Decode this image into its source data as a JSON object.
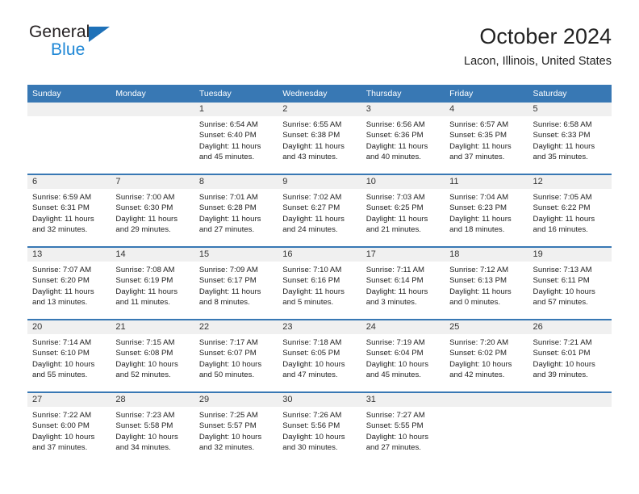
{
  "logo": {
    "text_dark": "General",
    "text_blue": "Blue",
    "triangle_color": "#1e71b8",
    "blue_color": "#1e87d6"
  },
  "header": {
    "title": "October 2024",
    "subtitle": "Lacon, Illinois, United States"
  },
  "theme": {
    "header_bg": "#3878b4",
    "daynum_bg": "#f0f0f0",
    "row_rule": "#3878b4"
  },
  "weekday_headers": [
    "Sunday",
    "Monday",
    "Tuesday",
    "Wednesday",
    "Thursday",
    "Friday",
    "Saturday"
  ],
  "weeks": [
    [
      {
        "day": "",
        "sunrise": "",
        "sunset": "",
        "daylight1": "",
        "daylight2": ""
      },
      {
        "day": "",
        "sunrise": "",
        "sunset": "",
        "daylight1": "",
        "daylight2": ""
      },
      {
        "day": "1",
        "sunrise": "Sunrise: 6:54 AM",
        "sunset": "Sunset: 6:40 PM",
        "daylight1": "Daylight: 11 hours",
        "daylight2": "and 45 minutes."
      },
      {
        "day": "2",
        "sunrise": "Sunrise: 6:55 AM",
        "sunset": "Sunset: 6:38 PM",
        "daylight1": "Daylight: 11 hours",
        "daylight2": "and 43 minutes."
      },
      {
        "day": "3",
        "sunrise": "Sunrise: 6:56 AM",
        "sunset": "Sunset: 6:36 PM",
        "daylight1": "Daylight: 11 hours",
        "daylight2": "and 40 minutes."
      },
      {
        "day": "4",
        "sunrise": "Sunrise: 6:57 AM",
        "sunset": "Sunset: 6:35 PM",
        "daylight1": "Daylight: 11 hours",
        "daylight2": "and 37 minutes."
      },
      {
        "day": "5",
        "sunrise": "Sunrise: 6:58 AM",
        "sunset": "Sunset: 6:33 PM",
        "daylight1": "Daylight: 11 hours",
        "daylight2": "and 35 minutes."
      }
    ],
    [
      {
        "day": "6",
        "sunrise": "Sunrise: 6:59 AM",
        "sunset": "Sunset: 6:31 PM",
        "daylight1": "Daylight: 11 hours",
        "daylight2": "and 32 minutes."
      },
      {
        "day": "7",
        "sunrise": "Sunrise: 7:00 AM",
        "sunset": "Sunset: 6:30 PM",
        "daylight1": "Daylight: 11 hours",
        "daylight2": "and 29 minutes."
      },
      {
        "day": "8",
        "sunrise": "Sunrise: 7:01 AM",
        "sunset": "Sunset: 6:28 PM",
        "daylight1": "Daylight: 11 hours",
        "daylight2": "and 27 minutes."
      },
      {
        "day": "9",
        "sunrise": "Sunrise: 7:02 AM",
        "sunset": "Sunset: 6:27 PM",
        "daylight1": "Daylight: 11 hours",
        "daylight2": "and 24 minutes."
      },
      {
        "day": "10",
        "sunrise": "Sunrise: 7:03 AM",
        "sunset": "Sunset: 6:25 PM",
        "daylight1": "Daylight: 11 hours",
        "daylight2": "and 21 minutes."
      },
      {
        "day": "11",
        "sunrise": "Sunrise: 7:04 AM",
        "sunset": "Sunset: 6:23 PM",
        "daylight1": "Daylight: 11 hours",
        "daylight2": "and 18 minutes."
      },
      {
        "day": "12",
        "sunrise": "Sunrise: 7:05 AM",
        "sunset": "Sunset: 6:22 PM",
        "daylight1": "Daylight: 11 hours",
        "daylight2": "and 16 minutes."
      }
    ],
    [
      {
        "day": "13",
        "sunrise": "Sunrise: 7:07 AM",
        "sunset": "Sunset: 6:20 PM",
        "daylight1": "Daylight: 11 hours",
        "daylight2": "and 13 minutes."
      },
      {
        "day": "14",
        "sunrise": "Sunrise: 7:08 AM",
        "sunset": "Sunset: 6:19 PM",
        "daylight1": "Daylight: 11 hours",
        "daylight2": "and 11 minutes."
      },
      {
        "day": "15",
        "sunrise": "Sunrise: 7:09 AM",
        "sunset": "Sunset: 6:17 PM",
        "daylight1": "Daylight: 11 hours",
        "daylight2": "and 8 minutes."
      },
      {
        "day": "16",
        "sunrise": "Sunrise: 7:10 AM",
        "sunset": "Sunset: 6:16 PM",
        "daylight1": "Daylight: 11 hours",
        "daylight2": "and 5 minutes."
      },
      {
        "day": "17",
        "sunrise": "Sunrise: 7:11 AM",
        "sunset": "Sunset: 6:14 PM",
        "daylight1": "Daylight: 11 hours",
        "daylight2": "and 3 minutes."
      },
      {
        "day": "18",
        "sunrise": "Sunrise: 7:12 AM",
        "sunset": "Sunset: 6:13 PM",
        "daylight1": "Daylight: 11 hours",
        "daylight2": "and 0 minutes."
      },
      {
        "day": "19",
        "sunrise": "Sunrise: 7:13 AM",
        "sunset": "Sunset: 6:11 PM",
        "daylight1": "Daylight: 10 hours",
        "daylight2": "and 57 minutes."
      }
    ],
    [
      {
        "day": "20",
        "sunrise": "Sunrise: 7:14 AM",
        "sunset": "Sunset: 6:10 PM",
        "daylight1": "Daylight: 10 hours",
        "daylight2": "and 55 minutes."
      },
      {
        "day": "21",
        "sunrise": "Sunrise: 7:15 AM",
        "sunset": "Sunset: 6:08 PM",
        "daylight1": "Daylight: 10 hours",
        "daylight2": "and 52 minutes."
      },
      {
        "day": "22",
        "sunrise": "Sunrise: 7:17 AM",
        "sunset": "Sunset: 6:07 PM",
        "daylight1": "Daylight: 10 hours",
        "daylight2": "and 50 minutes."
      },
      {
        "day": "23",
        "sunrise": "Sunrise: 7:18 AM",
        "sunset": "Sunset: 6:05 PM",
        "daylight1": "Daylight: 10 hours",
        "daylight2": "and 47 minutes."
      },
      {
        "day": "24",
        "sunrise": "Sunrise: 7:19 AM",
        "sunset": "Sunset: 6:04 PM",
        "daylight1": "Daylight: 10 hours",
        "daylight2": "and 45 minutes."
      },
      {
        "day": "25",
        "sunrise": "Sunrise: 7:20 AM",
        "sunset": "Sunset: 6:02 PM",
        "daylight1": "Daylight: 10 hours",
        "daylight2": "and 42 minutes."
      },
      {
        "day": "26",
        "sunrise": "Sunrise: 7:21 AM",
        "sunset": "Sunset: 6:01 PM",
        "daylight1": "Daylight: 10 hours",
        "daylight2": "and 39 minutes."
      }
    ],
    [
      {
        "day": "27",
        "sunrise": "Sunrise: 7:22 AM",
        "sunset": "Sunset: 6:00 PM",
        "daylight1": "Daylight: 10 hours",
        "daylight2": "and 37 minutes."
      },
      {
        "day": "28",
        "sunrise": "Sunrise: 7:23 AM",
        "sunset": "Sunset: 5:58 PM",
        "daylight1": "Daylight: 10 hours",
        "daylight2": "and 34 minutes."
      },
      {
        "day": "29",
        "sunrise": "Sunrise: 7:25 AM",
        "sunset": "Sunset: 5:57 PM",
        "daylight1": "Daylight: 10 hours",
        "daylight2": "and 32 minutes."
      },
      {
        "day": "30",
        "sunrise": "Sunrise: 7:26 AM",
        "sunset": "Sunset: 5:56 PM",
        "daylight1": "Daylight: 10 hours",
        "daylight2": "and 30 minutes."
      },
      {
        "day": "31",
        "sunrise": "Sunrise: 7:27 AM",
        "sunset": "Sunset: 5:55 PM",
        "daylight1": "Daylight: 10 hours",
        "daylight2": "and 27 minutes."
      },
      {
        "day": "",
        "sunrise": "",
        "sunset": "",
        "daylight1": "",
        "daylight2": ""
      },
      {
        "day": "",
        "sunrise": "",
        "sunset": "",
        "daylight1": "",
        "daylight2": ""
      }
    ]
  ]
}
